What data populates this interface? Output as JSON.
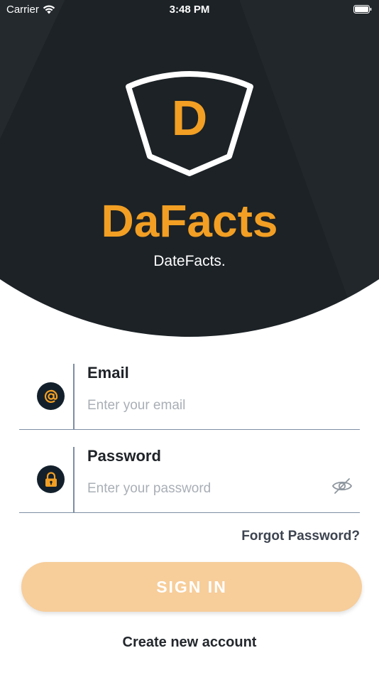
{
  "status_bar": {
    "carrier": "Carrier",
    "time": "3:48 PM"
  },
  "brand": {
    "logo_letter": "D",
    "name": "DaFacts",
    "tagline": "DateFacts."
  },
  "form": {
    "email": {
      "label": "Email",
      "placeholder": "Enter your email",
      "icon": "at-sign-icon"
    },
    "password": {
      "label": "Password",
      "placeholder": "Enter your password",
      "icon": "padlock-icon",
      "toggle_icon": "eye-slash-icon"
    },
    "forgot_label": "Forgot Password?",
    "signin_label": "SIGN IN",
    "create_label": "Create new account"
  },
  "colors": {
    "accent": "#f29f24",
    "header_bg": "#1c2226",
    "button_bg": "#f7cd9a",
    "icon_badge_bg": "#13202c"
  }
}
